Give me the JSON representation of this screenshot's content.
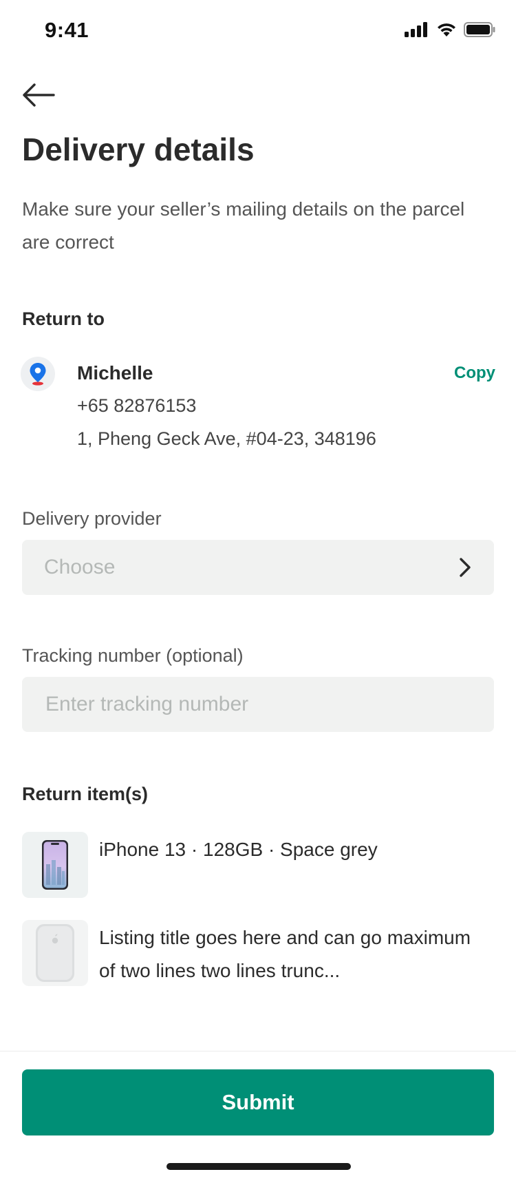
{
  "status_bar": {
    "time": "9:41",
    "icons": [
      "cellular-signal-icon",
      "wifi-icon",
      "battery-icon"
    ]
  },
  "header": {
    "back_icon": "arrow-left-icon",
    "title": "Delivery details",
    "subtitle": "Make sure your seller’s mailing details on the parcel are correct"
  },
  "return_to": {
    "section_label": "Return to",
    "icon": "location-pin-icon",
    "name": "Michelle",
    "phone": "+65 82876153",
    "address": "1, Pheng Geck Ave, #04-23, 348196",
    "copy_label": "Copy"
  },
  "delivery_provider": {
    "label": "Delivery provider",
    "placeholder": "Choose",
    "icon": "chevron-right-icon"
  },
  "tracking": {
    "label": "Tracking number (optional)",
    "placeholder": "Enter tracking number"
  },
  "return_items": {
    "section_label": "Return item(s)",
    "items": [
      {
        "title": "iPhone 13 · 128GB · Space grey",
        "thumb": "phone-image"
      },
      {
        "title": "Listing title goes here and can go maximum of two lines two lines trunc...",
        "thumb": "magsafe-battery-image"
      }
    ]
  },
  "footer": {
    "submit_label": "Submit"
  },
  "colors": {
    "accent": "#008f76",
    "field_bg": "#f1f2f1",
    "text_primary": "#2b2b2b",
    "text_secondary": "#555555",
    "placeholder": "#b4b8b6"
  }
}
